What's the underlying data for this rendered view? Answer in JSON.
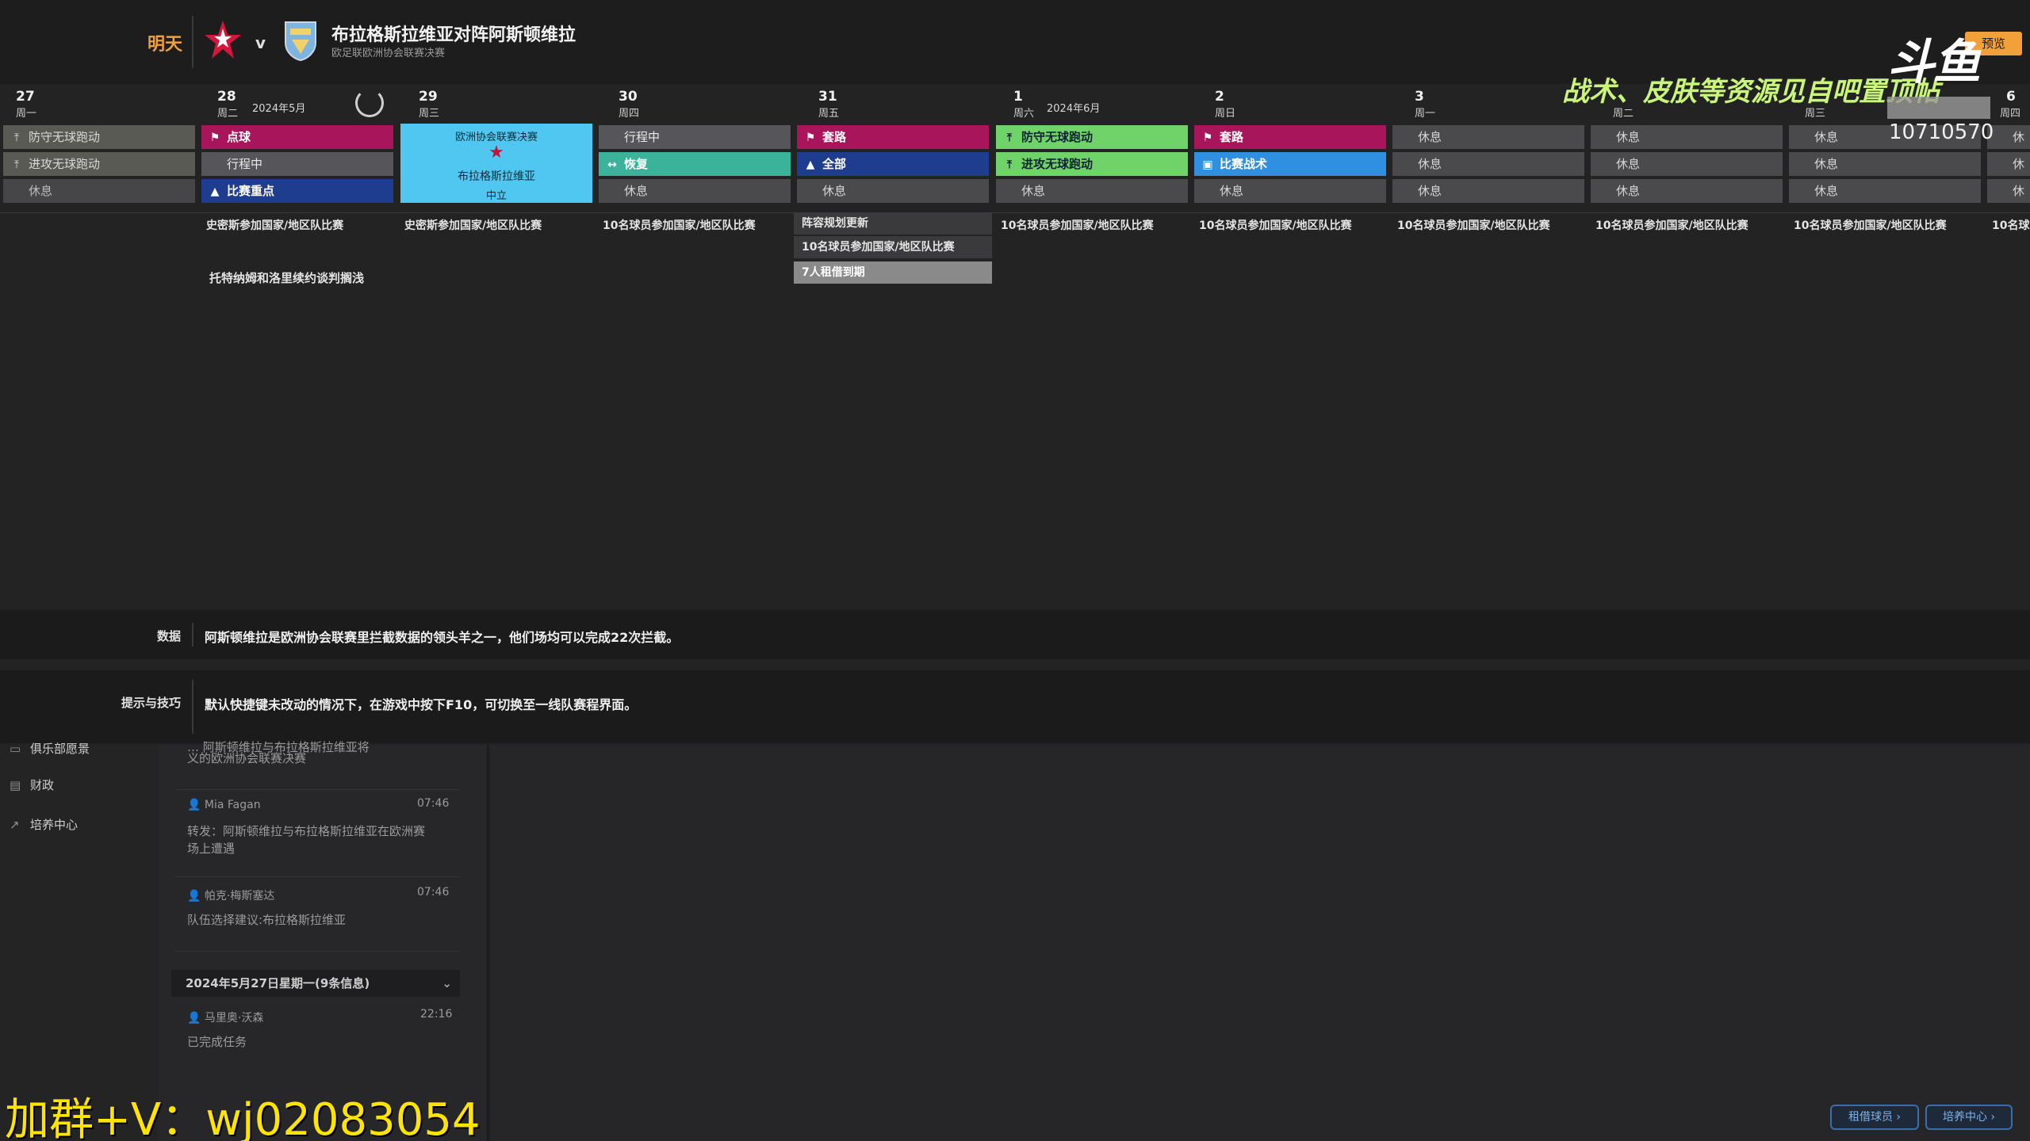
{
  "header": {
    "day_label": "明天",
    "vs": "v",
    "title": "布拉格斯拉维亚对阵阿斯顿维拉",
    "subtitle": "欧足联欧洲协会联赛决赛",
    "button_label": "预览",
    "home_crest_icon": "slavia-star-crest-icon",
    "away_crest_icon": "aston-villa-crest-icon"
  },
  "calendar": {
    "days": [
      {
        "num": "27",
        "wd": "周一",
        "month": ""
      },
      {
        "num": "28",
        "wd": "周二",
        "month": "2024年5月"
      },
      {
        "num": "29",
        "wd": "周三",
        "month": ""
      },
      {
        "num": "30",
        "wd": "周四",
        "month": ""
      },
      {
        "num": "31",
        "wd": "周五",
        "month": ""
      },
      {
        "num": "1",
        "wd": "周六",
        "month": "2024年6月"
      },
      {
        "num": "2",
        "wd": "周日",
        "month": ""
      },
      {
        "num": "3",
        "wd": "周一",
        "month": ""
      },
      {
        "num": "",
        "wd": "周二",
        "month": ""
      },
      {
        "num": "",
        "wd": "周三",
        "month": ""
      },
      {
        "num": "6",
        "wd": "周四",
        "month": ""
      }
    ],
    "slots": {
      "d0": [
        "防守无球跑动",
        "进攻无球跑动",
        "休息"
      ],
      "d1": [
        "点球",
        "行程中",
        "比赛重点"
      ],
      "d3": [
        "行程中",
        "恢复",
        "休息"
      ],
      "d4": [
        "套路",
        "全部",
        "休息"
      ],
      "d5": [
        "防守无球跑动",
        "进攻无球跑动",
        "休息"
      ],
      "d6": [
        "套路",
        "比赛战术",
        "休息"
      ],
      "d7": [
        "休息",
        "休息",
        "休息"
      ],
      "d8": [
        "休息",
        "休息",
        "休息"
      ],
      "d9": [
        "休息",
        "休息",
        "休息"
      ],
      "d10": [
        "休",
        "休",
        "休"
      ]
    },
    "match_card": {
      "competition": "欧洲协会联赛决赛",
      "opponent": "布拉格斯拉维亚",
      "venue": "中立"
    },
    "events": {
      "d1": "史密斯参加国家/地区队比赛",
      "d2": "史密斯参加国家/地区队比赛",
      "d3": "10名球员参加国家/地区队比赛",
      "d4a": "阵容规划更新",
      "d4b": "10名球员参加国家/地区队比赛",
      "d4c": "7人租借到期",
      "d5": "10名球员参加国家/地区队比赛",
      "d6": "10名球员参加国家/地区队比赛",
      "d7": "10名球员参加国家/地区队比赛",
      "d8": "10名球员参加国家/地区队比赛",
      "d9": "10名球员参加国家/地区队比赛",
      "d10": "10名球",
      "note": "托特纳姆和洛里续约谈判搁浅"
    }
  },
  "info": {
    "data_label": "数据",
    "data_text": "阿斯顿维拉是欧洲协会联赛里拦截数据的领头羊之一，他们场均可以完成22次拦截。",
    "tips_label": "提示与技巧",
    "tips_text": "默认快捷键未改动的情况下，在游戏中按下F10，可切换至一线队赛程界面。"
  },
  "sidebar": {
    "items": [
      {
        "label": "俱乐部愿景",
        "icon": "vision-icon"
      },
      {
        "label": "财政",
        "icon": "finance-icon"
      },
      {
        "label": "培养中心",
        "icon": "development-icon"
      }
    ]
  },
  "feed": {
    "top_text_1": "… 阿斯顿维拉与布拉格斯拉维亚将",
    "top_text_2": "义的欧洲协会联赛决赛",
    "msg1_name": "Mia Fagan",
    "msg1_time": "07:46",
    "msg1_text_1": "转发：阿斯顿维拉与布拉格斯拉维亚在欧洲赛",
    "msg1_text_2": "场上遭遇",
    "msg2_name": "帕克·梅斯塞达",
    "msg2_time": "07:46",
    "msg2_text": "队伍选择建议:布拉格斯拉维亚",
    "date_header": "2024年5月27日星期一(9条信息)",
    "msg3_name": "马里奥·沃森",
    "msg3_time": "22:16",
    "msg3_text": "已完成任务"
  },
  "lower_buttons": {
    "loan": "租借球员 ›",
    "dev": "培养中心 ›"
  },
  "watermarks": {
    "green": "战术、皮肤等资源见自吧置顶帖",
    "logo": "斗鱼",
    "number": "10710570",
    "bottom": "加群+V：wj02083054"
  },
  "colors": {
    "magenta": "#a8155b",
    "navy": "#1f3d8f",
    "green": "#6fd36a",
    "teal": "#3bb39b",
    "blue": "#2f8fe0",
    "match": "#4fc7f0",
    "accent": "#f2a13a"
  }
}
